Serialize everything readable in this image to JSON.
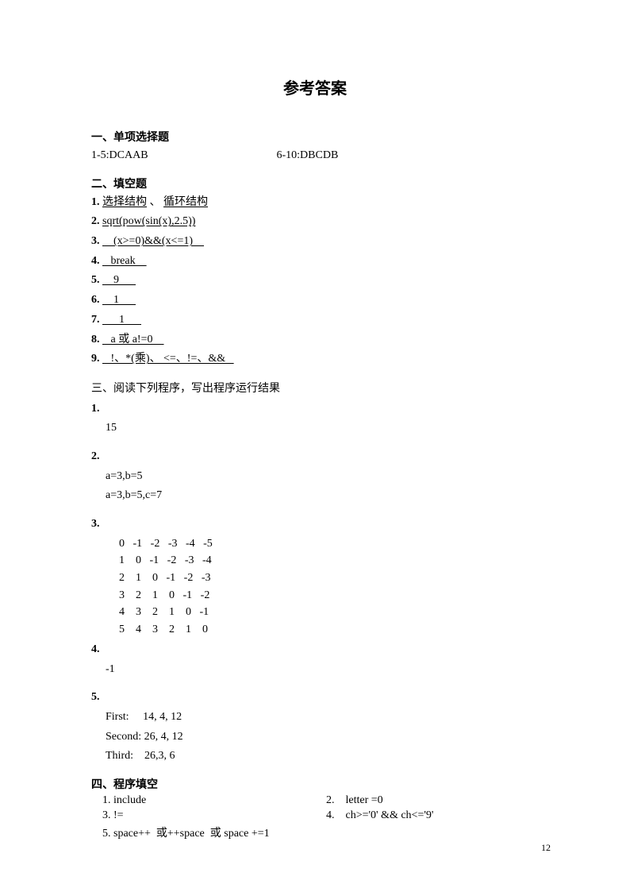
{
  "title": "参考答案",
  "s1": {
    "head": "一、单项选择题",
    "a15_label": "1-5:DCAAB",
    "a610_label": "6-10:DBCDB"
  },
  "s2": {
    "head": "二、填空题",
    "q1": {
      "n": "1.",
      "a": "选择结构",
      "sep": "、",
      "b": "循环结构"
    },
    "q2": {
      "n": "2.",
      "a": "sqrt(pow(sin(x),2.5))"
    },
    "q3": {
      "n": "3.",
      "a": "    (x>=0)&&(x<=1)    "
    },
    "q4": {
      "n": "4.",
      "a": "   break    "
    },
    "q5": {
      "n": "5.",
      "a": "    9      "
    },
    "q6": {
      "n": "6.",
      "a": "    1      "
    },
    "q7": {
      "n": "7.",
      "a": "      1      "
    },
    "q8": {
      "n": "8.",
      "a": "   a 或 a!=0    "
    },
    "q9": {
      "n": "9.",
      "a": "   !、*(乘)、 <=、!=、&&   "
    }
  },
  "s3": {
    "head": "三、阅读下列程序，写出程序运行结果",
    "q1": {
      "n": "1.",
      "a": "15"
    },
    "q2": {
      "n": "2.",
      "l1": "a=3,b=5",
      "l2": "a=3,b=5,c=7"
    },
    "q3": {
      "n": "3.",
      "matrix": "  0   -1   -2   -3   -4   -5\n  1    0   -1   -2   -3   -4\n  2    1    0   -1   -2   -3\n  3    2    1    0   -1   -2\n  4    3    2    1    0   -1\n  5    4    3    2    1    0"
    },
    "q4": {
      "n": "4.",
      "a": "-1"
    },
    "q5": {
      "n": "5.",
      "l1": "First:     14, 4, 12",
      "l2": "Second: 26, 4, 12",
      "l3": "Third:    26,3, 6"
    }
  },
  "s4": {
    "head": "四、程序填空",
    "i1": "1. include",
    "i2": "2.    letter =0",
    "i3": "3. !=",
    "i4": "4.    ch>='0' && ch<='9'",
    "i5": "5. space++  或++space  或 space +=1"
  },
  "page": "12"
}
